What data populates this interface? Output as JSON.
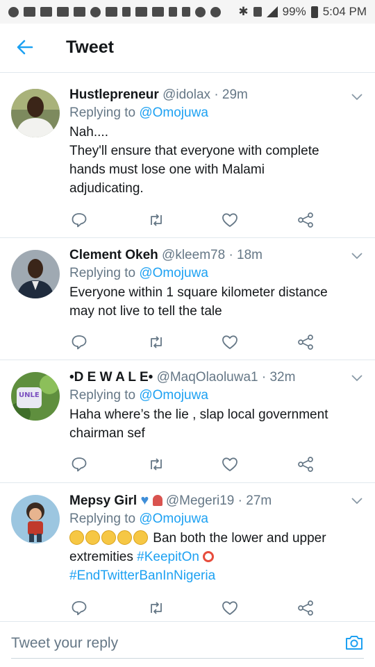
{
  "status_bar": {
    "battery": "99%",
    "time": "5:04 PM"
  },
  "header": {
    "title": "Tweet"
  },
  "tweets": [
    {
      "name": "Hustlepreneur",
      "handle": "@idolax",
      "separator": "·",
      "time": "29m",
      "replying_prefix": "Replying to",
      "replying_to": "@Omojuwa",
      "body_lines": [
        "Nah....",
        "They'll ensure that everyone with complete",
        "hands must lose one with Malami",
        "adjudicating."
      ]
    },
    {
      "name": "Clement Okeh",
      "handle": "@kleem78",
      "separator": "·",
      "time": "18m",
      "replying_prefix": "Replying to",
      "replying_to": "@Omojuwa",
      "body_lines": [
        "Everyone within 1 square kilometer distance",
        "may not live to tell the tale"
      ]
    },
    {
      "name": "•D E W A L E•",
      "handle": "@MaqOlaoluwa1",
      "separator": "·",
      "time": "32m",
      "replying_prefix": "Replying to",
      "replying_to": "@Omojuwa",
      "body_lines": [
        "Haha where’s the lie , slap local government",
        "chairman sef"
      ]
    },
    {
      "name": "Mepsy Girl",
      "handle": "@Megeri19",
      "separator": "·",
      "time": "27m",
      "replying_prefix": "Replying to",
      "replying_to": "@Omojuwa",
      "body_text": "Ban both the lower and upper",
      "body_text2": "extremities",
      "hashtag1": "#KeepitOn",
      "hashtag2": "#EndTwitterBanInNigeria"
    }
  ],
  "composer": {
    "placeholder": "Tweet your reply"
  },
  "colors": {
    "accent": "#1da1f2",
    "muted": "#657786",
    "text": "#14171a"
  }
}
